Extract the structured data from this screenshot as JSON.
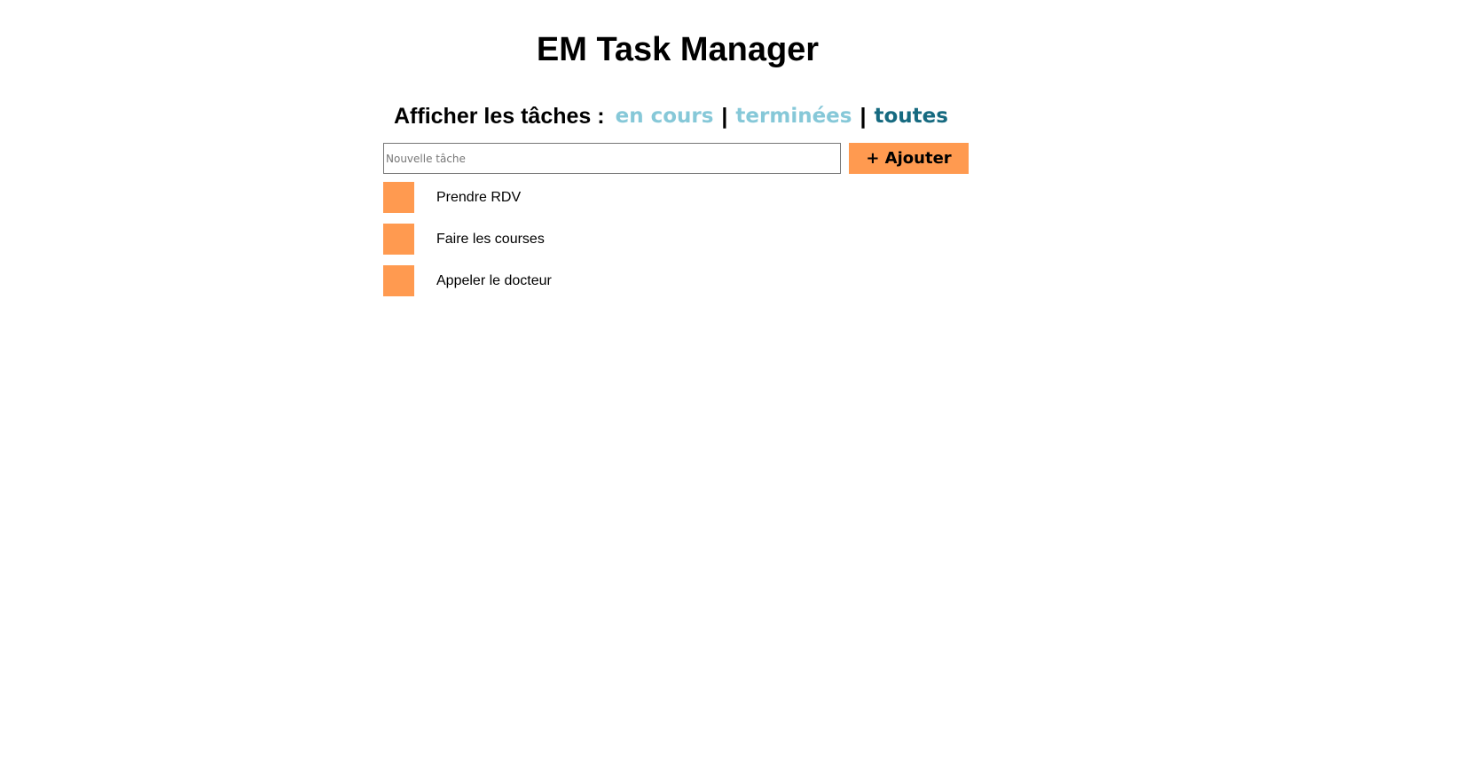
{
  "app": {
    "title": "EM Task Manager"
  },
  "filter": {
    "label": "Afficher les tâches :",
    "options": [
      {
        "label": "en cours",
        "active": false
      },
      {
        "label": "terminées",
        "active": false
      },
      {
        "label": "toutes",
        "active": true
      }
    ],
    "separator": "|"
  },
  "new_task": {
    "placeholder": "Nouvelle tâche",
    "value": "",
    "add_label": "+ Ajouter"
  },
  "tasks": [
    {
      "label": "Prendre RDV",
      "done": false
    },
    {
      "label": "Faire les courses",
      "done": false
    },
    {
      "label": "Appeler le docteur",
      "done": false
    }
  ],
  "colors": {
    "accent": "#ff9a50",
    "link_inactive": "#86c8d8",
    "link_active": "#166a80"
  }
}
